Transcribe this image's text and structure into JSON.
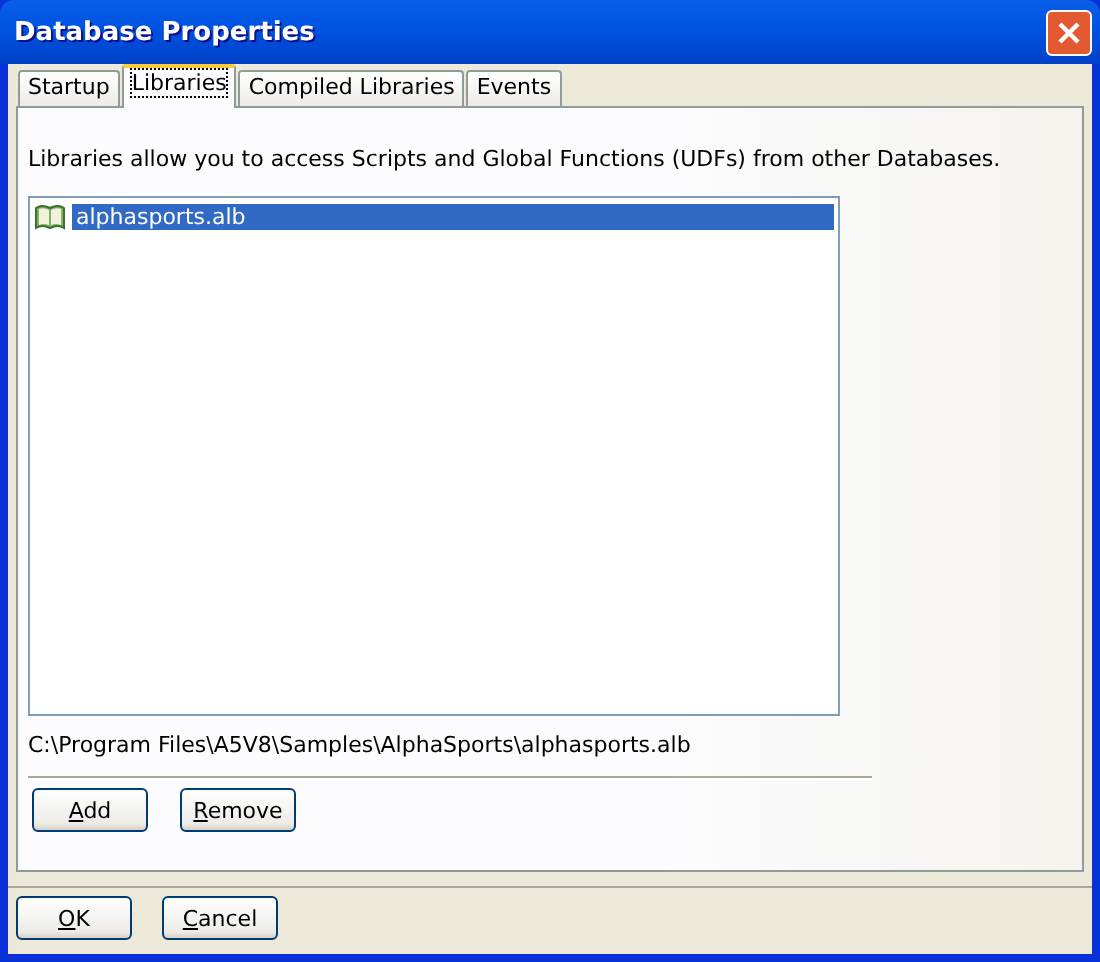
{
  "window": {
    "title": "Database Properties"
  },
  "tabs": [
    {
      "label": "Startup",
      "selected": false
    },
    {
      "label": "Libraries",
      "selected": true
    },
    {
      "label": "Compiled Libraries",
      "selected": false
    },
    {
      "label": "Events",
      "selected": false
    }
  ],
  "description": "Libraries allow you to access Scripts and Global Functions (UDFs) from other Databases.",
  "libraries": [
    {
      "name": "alphasports.alb",
      "selected": true
    }
  ],
  "path": "C:\\Program Files\\A5V8\\Samples\\AlphaSports\\alphasports.alb",
  "panel_buttons": [
    "Add",
    "Remove"
  ],
  "dialog_buttons": [
    "OK",
    "Cancel"
  ]
}
